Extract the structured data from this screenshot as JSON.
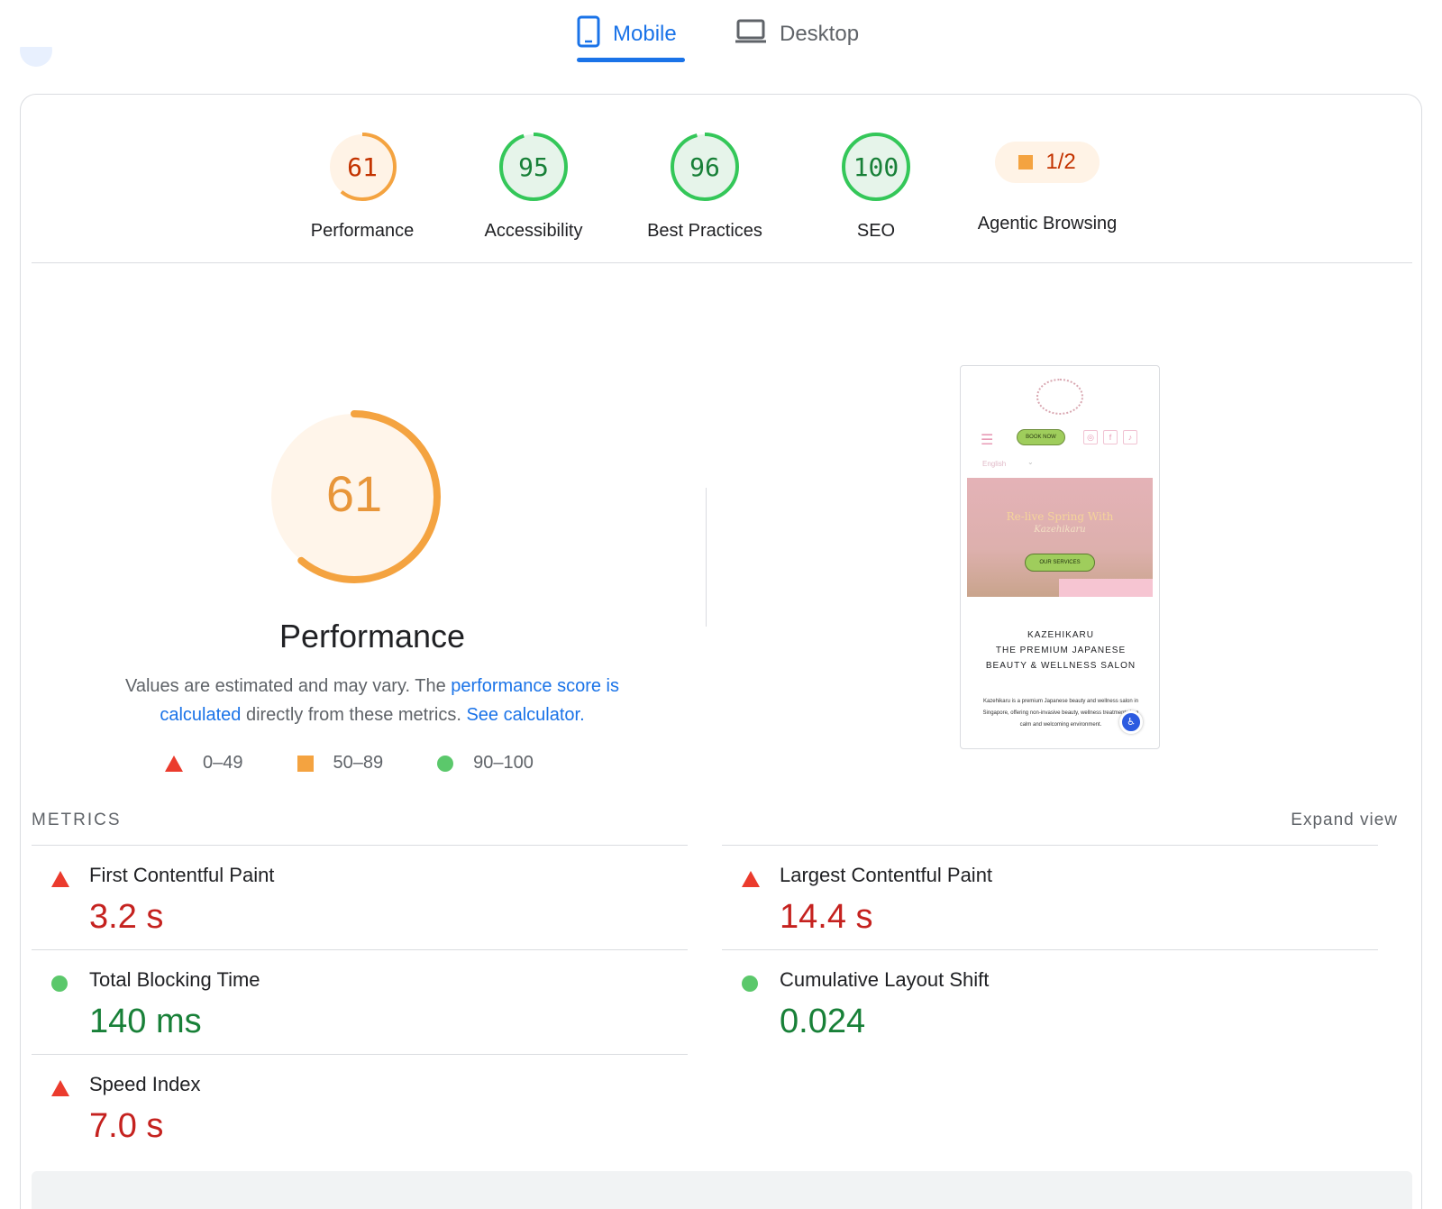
{
  "tabs": [
    {
      "label": "Mobile",
      "icon": "phone-icon",
      "active": true
    },
    {
      "label": "Desktop",
      "icon": "laptop-icon",
      "active": false
    }
  ],
  "categories": [
    {
      "score": "61",
      "value": 61,
      "label": "Performance",
      "status": "average"
    },
    {
      "score": "95",
      "value": 95,
      "label": "Accessibility",
      "status": "pass"
    },
    {
      "score": "96",
      "value": 96,
      "label": "Best Practices",
      "status": "pass"
    },
    {
      "score": "100",
      "value": 100,
      "label": "SEO",
      "status": "pass"
    },
    {
      "score": "1/2",
      "label": "Agentic Browsing",
      "status": "average"
    }
  ],
  "performance": {
    "score": "61",
    "value": 61,
    "title": "Performance",
    "desc_prefix": "Values are estimated and may vary. The ",
    "desc_link1": "performance score is calculated",
    "desc_mid": " directly from these metrics. ",
    "desc_link2": "See calculator.",
    "legend": [
      {
        "range": "0–49",
        "shape": "triangle"
      },
      {
        "range": "50–89",
        "shape": "square"
      },
      {
        "range": "90–100",
        "shape": "circle"
      }
    ]
  },
  "screenshot": {
    "book_now": "BOOK NOW",
    "language": "English",
    "hero_title": "Re-live Spring With",
    "hero_subtitle": "Kazehikaru",
    "services_button": "OUR SERVICES",
    "heading_line1": "KAZEHIKARU",
    "heading_line2": "THE PREMIUM JAPANESE",
    "heading_line3": "BEAUTY & WELLNESS SALON",
    "body": "Kazehikaru is a premium Japanese beauty and wellness salon in Singapore, offering non-invasive beauty, wellness treatments in a calm and welcoming environment."
  },
  "metrics": {
    "heading": "METRICS",
    "expand_label": "Expand view",
    "left": [
      {
        "name": "First Contentful Paint",
        "value": "3.2 s",
        "status": "fail"
      },
      {
        "name": "Total Blocking Time",
        "value": "140 ms",
        "status": "pass"
      },
      {
        "name": "Speed Index",
        "value": "7.0 s",
        "status": "fail"
      }
    ],
    "right": [
      {
        "name": "Largest Contentful Paint",
        "value": "14.4 s",
        "status": "fail"
      },
      {
        "name": "Cumulative Layout Shift",
        "value": "0.024",
        "status": "pass"
      }
    ]
  },
  "colors": {
    "accent_blue": "#1a73e8",
    "fail_red": "#c5221f",
    "average_orange": "#f4a340",
    "pass_green": "#188038"
  }
}
